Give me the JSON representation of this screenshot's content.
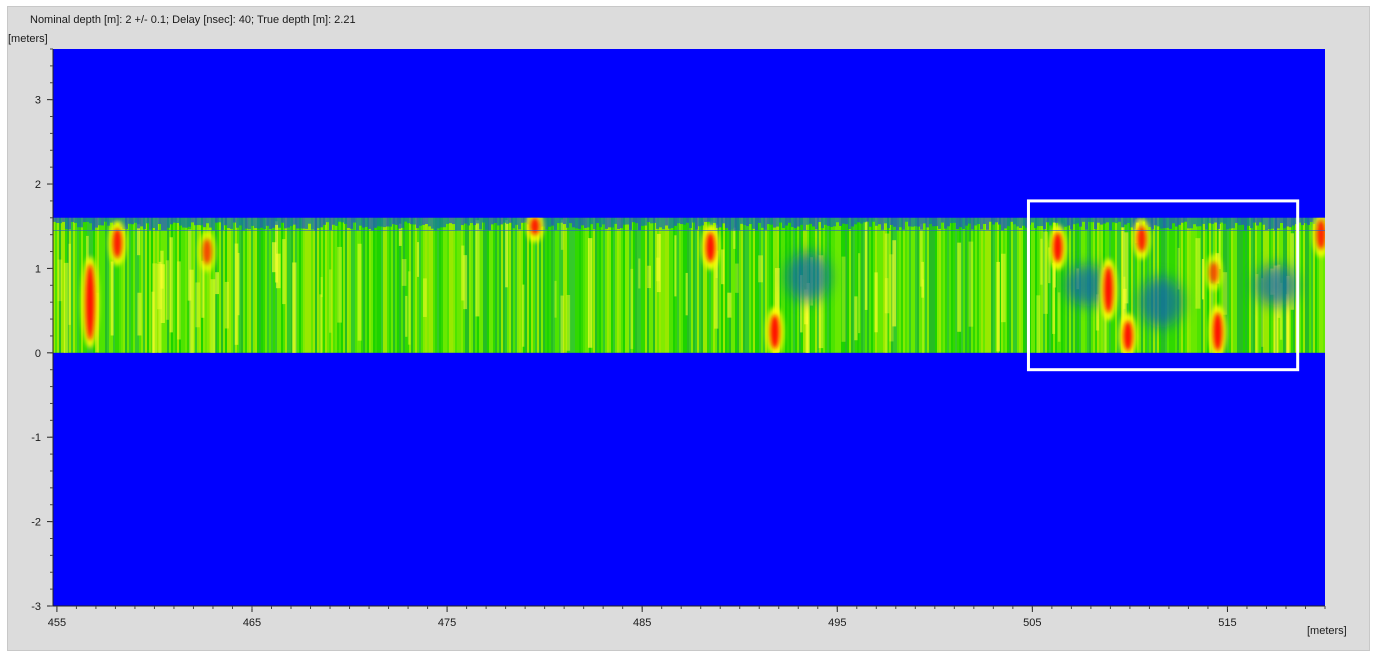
{
  "header": {
    "info_text": "Nominal depth [m]: 2 +/- 0.1;   Delay [nsec]: 40;   True depth [m]: 2.21"
  },
  "axes": {
    "y_unit_label": "[meters]",
    "x_unit_label": "[meters]"
  },
  "colors": {
    "panel_background": "#dcdcdc",
    "plot_background": "#0000ff",
    "colormap": [
      "#1030d8",
      "#00a060",
      "#00d000",
      "#80ff00",
      "#ffff00",
      "#ff0000"
    ],
    "highlight_box": "#ffffff"
  },
  "chart_data": {
    "type": "heatmap",
    "title": "",
    "xlabel": "[meters]",
    "ylabel": "[meters]",
    "xlim": [
      454.8,
      520
    ],
    "ylim": [
      -3,
      3.6
    ],
    "x_ticks": [
      455,
      465,
      475,
      485,
      495,
      505,
      515
    ],
    "x_tick_labels": [
      "455",
      "465",
      "475",
      "485",
      "495",
      "505",
      "515"
    ],
    "y_ticks": [
      3,
      2,
      1,
      0,
      -1,
      -2,
      -3
    ],
    "y_tick_labels": [
      "3",
      "2",
      "1",
      "0",
      "-1",
      "-2",
      "-3"
    ],
    "grid": false,
    "data_band": {
      "y_bottom": 0.0,
      "y_top": 1.6,
      "y_top_dense": 1.45
    },
    "hotspots": [
      {
        "x": 456.7,
        "y": 0.6,
        "height": 0.9,
        "level": 1.0
      },
      {
        "x": 458.1,
        "y": 1.3,
        "height": 0.35,
        "level": 0.95
      },
      {
        "x": 462.7,
        "y": 1.2,
        "height": 0.3,
        "level": 0.75
      },
      {
        "x": 479.5,
        "y": 1.5,
        "height": 0.2,
        "level": 0.95
      },
      {
        "x": 488.5,
        "y": 1.25,
        "height": 0.35,
        "level": 1.0
      },
      {
        "x": 491.8,
        "y": 0.25,
        "height": 0.4,
        "level": 1.0
      },
      {
        "x": 506.3,
        "y": 1.25,
        "height": 0.35,
        "level": 1.0
      },
      {
        "x": 508.9,
        "y": 0.75,
        "height": 0.55,
        "level": 1.0
      },
      {
        "x": 509.9,
        "y": 0.2,
        "height": 0.35,
        "level": 1.0
      },
      {
        "x": 510.6,
        "y": 1.35,
        "height": 0.3,
        "level": 0.9
      },
      {
        "x": 514.5,
        "y": 0.25,
        "height": 0.45,
        "level": 1.0
      },
      {
        "x": 514.3,
        "y": 0.95,
        "height": 0.25,
        "level": 0.7
      },
      {
        "x": 519.8,
        "y": 1.4,
        "height": 0.35,
        "level": 0.9
      }
    ],
    "cool_regions": [
      {
        "x": 493.5,
        "y": 0.9,
        "height": 0.6
      },
      {
        "x": 507.8,
        "y": 0.8,
        "height": 0.5
      },
      {
        "x": 511.6,
        "y": 0.6,
        "height": 0.6
      },
      {
        "x": 517.5,
        "y": 0.8,
        "height": 0.5
      }
    ],
    "highlight_region": {
      "x_start": 504.8,
      "x_end": 518.6,
      "y_start": -0.2,
      "y_end": 1.8
    }
  }
}
